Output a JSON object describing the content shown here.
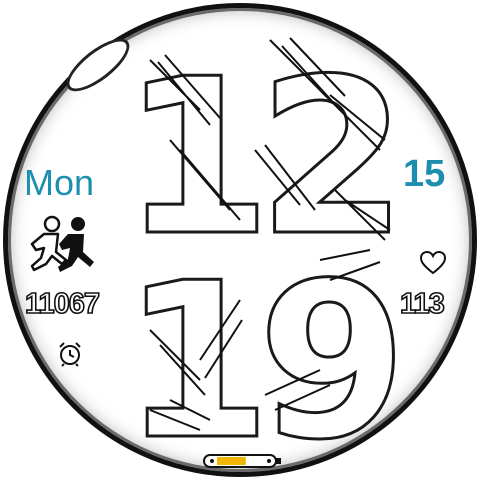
{
  "time": {
    "hours": "12",
    "minutes": "19"
  },
  "date": {
    "day_of_week": "Mon",
    "day_of_month": "15"
  },
  "steps": {
    "icon": "running-people-icon",
    "value": "11067"
  },
  "heart_rate": {
    "icon": "heart-icon",
    "value": "113"
  },
  "alarm": {
    "icon": "alarm-clock-icon"
  },
  "battery": {
    "icon": "battery-icon",
    "level_fraction": 0.6,
    "fill_color": "#f2b705"
  },
  "colors": {
    "accent": "#1c8fae",
    "outline": "#111111",
    "background": "#ffffff"
  }
}
